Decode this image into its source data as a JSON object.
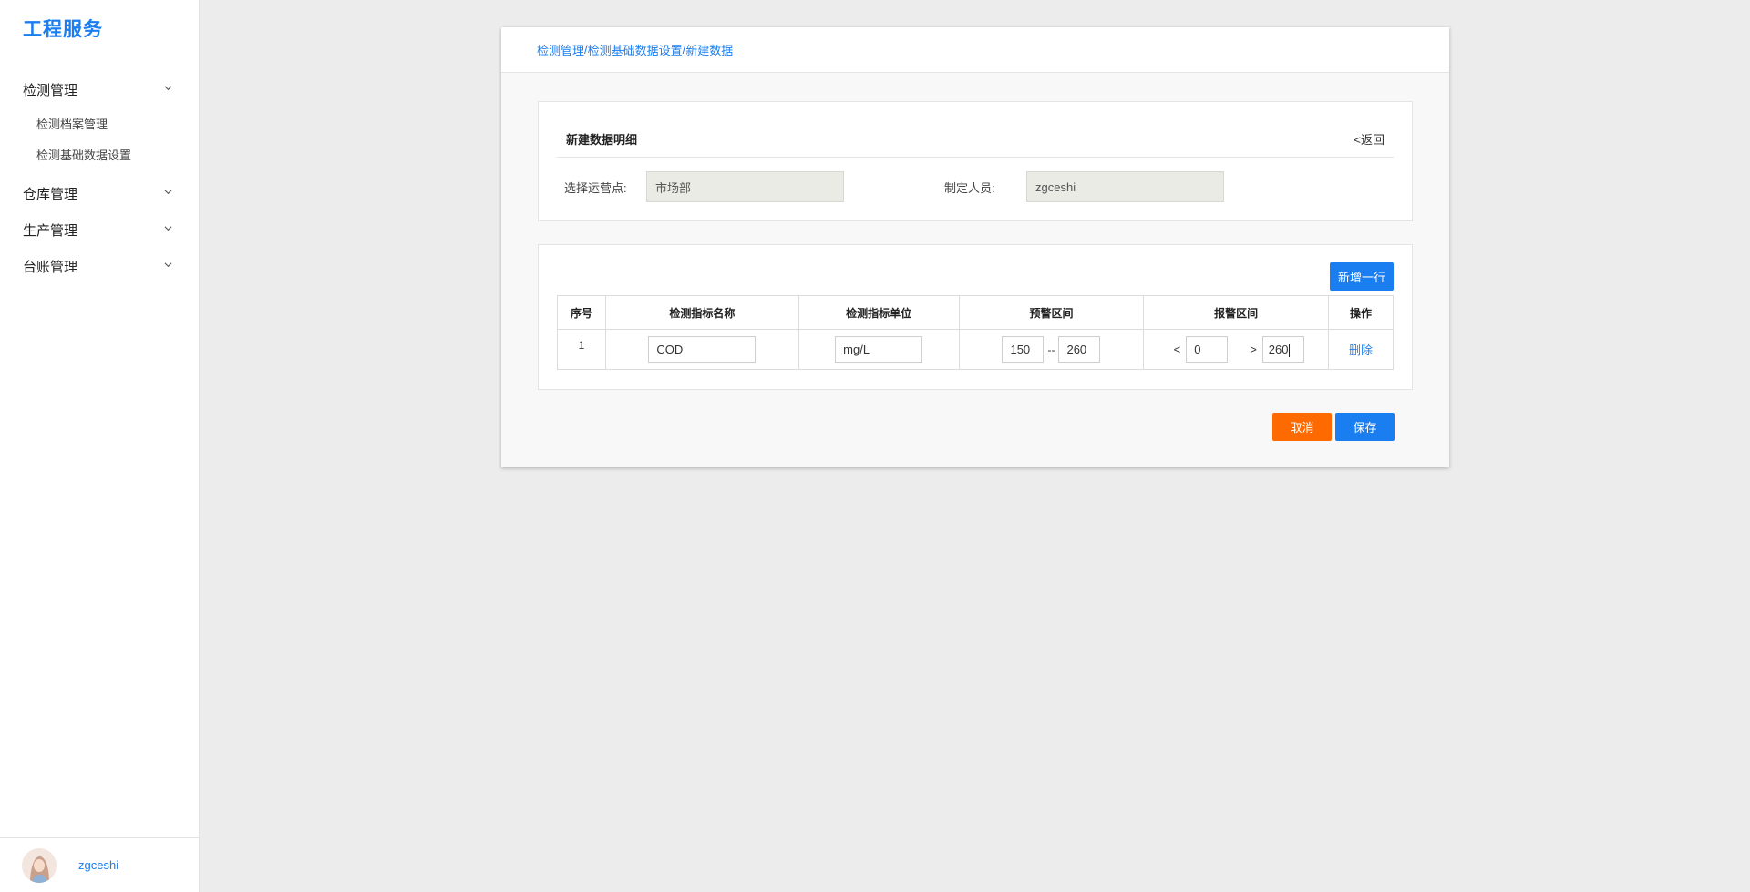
{
  "app": {
    "title": "工程服务"
  },
  "sidebar": {
    "groups": [
      {
        "label": "检测管理",
        "items": [
          "检测档案管理",
          "检测基础数据设置"
        ]
      },
      {
        "label": "仓库管理"
      },
      {
        "label": "生产管理"
      },
      {
        "label": "台账管理"
      }
    ],
    "user": {
      "name": "zgceshi"
    }
  },
  "breadcrumb": {
    "items": [
      "检测管理",
      "检测基础数据设置",
      "新建数据"
    ],
    "separator": "/"
  },
  "detail": {
    "title": "新建数据明细",
    "back_label": "<返回",
    "fields": {
      "site_label": "选择运营点:",
      "site_value": "市场部",
      "creator_label": "制定人员:",
      "creator_value": "zgceshi"
    }
  },
  "table": {
    "add_row_label": "新增一行",
    "headers": [
      "序号",
      "检测指标名称",
      "检测指标单位",
      "预警区间",
      "报警区间",
      "操作"
    ],
    "rows": [
      {
        "index": "1",
        "name": "COD",
        "unit": "mg/L",
        "warn_min": "150",
        "warn_sep": "--",
        "warn_max": "260",
        "alarm_lt_symbol": "<",
        "alarm_min": "0",
        "alarm_gt_symbol": ">",
        "alarm_max": "260",
        "action": "删除"
      }
    ]
  },
  "actions": {
    "cancel": "取消",
    "save": "保存"
  },
  "colors": {
    "primary": "#1a7df0",
    "danger": "#ff6a00",
    "background": "#ececec"
  },
  "icons": {
    "chevron": "chevron-down-icon"
  }
}
